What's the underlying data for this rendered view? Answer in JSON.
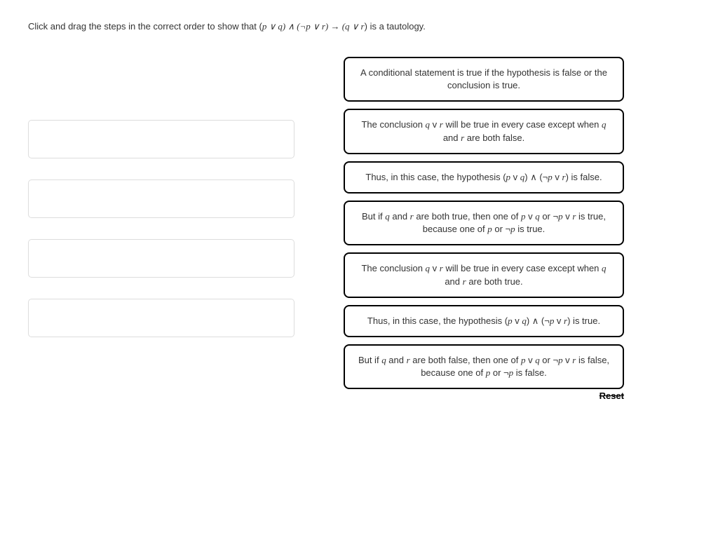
{
  "instruction": {
    "prefix": "Click and drag the steps in the correct order to show that (",
    "expr": "p ∨ q) ∧ (¬p ∨ r) → (q ∨ r",
    "suffix": ") is a tautology."
  },
  "dropSlotCount": 4,
  "cards": [
    {
      "segments": [
        {
          "t": "A conditional statement is true if the hypothesis is false or the conclusion is true.",
          "i": false
        }
      ]
    },
    {
      "segments": [
        {
          "t": "The conclusion ",
          "i": false
        },
        {
          "t": "q",
          "i": true
        },
        {
          "t": " v ",
          "i": false
        },
        {
          "t": "r",
          "i": true
        },
        {
          "t": " will be true in every case except when ",
          "i": false
        },
        {
          "t": "q",
          "i": true
        },
        {
          "t": " and ",
          "i": false
        },
        {
          "t": "r",
          "i": true
        },
        {
          "t": " are both false.",
          "i": false
        }
      ]
    },
    {
      "segments": [
        {
          "t": "Thus, in this case, the hypothesis (",
          "i": false
        },
        {
          "t": "p",
          "i": true
        },
        {
          "t": " v ",
          "i": false
        },
        {
          "t": "q",
          "i": true
        },
        {
          "t": ") ∧ (¬",
          "i": false
        },
        {
          "t": "p",
          "i": true
        },
        {
          "t": " v ",
          "i": false
        },
        {
          "t": "r",
          "i": true
        },
        {
          "t": ") is false.",
          "i": false
        }
      ]
    },
    {
      "segments": [
        {
          "t": "But if ",
          "i": false
        },
        {
          "t": "q",
          "i": true
        },
        {
          "t": " and ",
          "i": false
        },
        {
          "t": "r",
          "i": true
        },
        {
          "t": " are both true, then one of ",
          "i": false
        },
        {
          "t": "p",
          "i": true
        },
        {
          "t": " v ",
          "i": false
        },
        {
          "t": "q",
          "i": true
        },
        {
          "t": " or ¬",
          "i": false
        },
        {
          "t": "p",
          "i": true
        },
        {
          "t": " v ",
          "i": false
        },
        {
          "t": "r",
          "i": true
        },
        {
          "t": " is true, because one of ",
          "i": false
        },
        {
          "t": "p",
          "i": true
        },
        {
          "t": " or ¬",
          "i": false
        },
        {
          "t": "p",
          "i": true
        },
        {
          "t": " is true.",
          "i": false
        }
      ]
    },
    {
      "segments": [
        {
          "t": "The conclusion ",
          "i": false
        },
        {
          "t": "q",
          "i": true
        },
        {
          "t": " v ",
          "i": false
        },
        {
          "t": "r",
          "i": true
        },
        {
          "t": " will be true in every case except when ",
          "i": false
        },
        {
          "t": "q",
          "i": true
        },
        {
          "t": " and ",
          "i": false
        },
        {
          "t": "r",
          "i": true
        },
        {
          "t": " are both true.",
          "i": false
        }
      ]
    },
    {
      "segments": [
        {
          "t": "Thus, in this case, the hypothesis (",
          "i": false
        },
        {
          "t": "p",
          "i": true
        },
        {
          "t": " v ",
          "i": false
        },
        {
          "t": "q",
          "i": true
        },
        {
          "t": ") ∧ (¬",
          "i": false
        },
        {
          "t": "p",
          "i": true
        },
        {
          "t": " v ",
          "i": false
        },
        {
          "t": "r",
          "i": true
        },
        {
          "t": ") is true.",
          "i": false
        }
      ]
    },
    {
      "segments": [
        {
          "t": "But if ",
          "i": false
        },
        {
          "t": "q",
          "i": true
        },
        {
          "t": " and ",
          "i": false
        },
        {
          "t": "r",
          "i": true
        },
        {
          "t": " are both false, then one of ",
          "i": false
        },
        {
          "t": "p",
          "i": true
        },
        {
          "t": " v ",
          "i": false
        },
        {
          "t": "q",
          "i": true
        },
        {
          "t": " or ¬",
          "i": false
        },
        {
          "t": "p",
          "i": true
        },
        {
          "t": " v ",
          "i": false
        },
        {
          "t": "r",
          "i": true
        },
        {
          "t": " is false, because one of ",
          "i": false
        },
        {
          "t": "p",
          "i": true
        },
        {
          "t": " or ¬",
          "i": false
        },
        {
          "t": "p",
          "i": true
        },
        {
          "t": " is false.",
          "i": false
        }
      ]
    }
  ],
  "resetLabel": "Reset"
}
